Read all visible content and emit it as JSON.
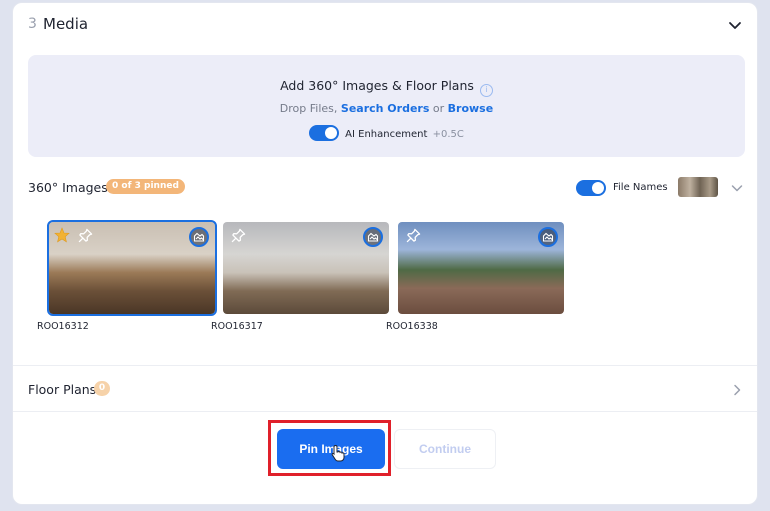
{
  "section": {
    "number": "3",
    "title": "Media"
  },
  "dropzone": {
    "title": "Add 360° Images & Floor Plans",
    "drop_text": "Drop Files,",
    "search_link": "Search Orders",
    "or_text": "or",
    "browse_link": "Browse",
    "ai_label": "AI Enhancement",
    "ai_cost": "+0.5C",
    "ai_enabled": true
  },
  "images": {
    "title": "360°  Images",
    "pinned_badge": "0 of 3 pinned",
    "file_names_label": "File Names",
    "file_names_enabled": true,
    "items": [
      {
        "name": "ROO16312",
        "starred": true,
        "selected": true
      },
      {
        "name": "ROO16317",
        "starred": false,
        "selected": false
      },
      {
        "name": "ROO16338",
        "starred": false,
        "selected": false
      }
    ]
  },
  "floor_plans": {
    "title": "Floor Plans",
    "count": "0"
  },
  "actions": {
    "pin_label": "Pin Images",
    "continue_label": "Continue"
  },
  "colors": {
    "accent": "#1a6df0",
    "badge": "#f3b679",
    "highlight": "#e0202a"
  }
}
